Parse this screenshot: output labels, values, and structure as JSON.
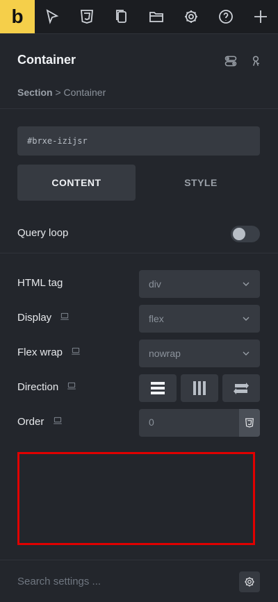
{
  "app": {
    "logo_letter": "b"
  },
  "topbar": {
    "icons": [
      "pointer-icon",
      "css3-icon",
      "pages-icon",
      "folder-icon",
      "settings-icon",
      "help-icon",
      "add-icon"
    ]
  },
  "panel": {
    "title": "Container",
    "breadcrumb": {
      "root": "Section",
      "separator": ">",
      "current": "Container"
    }
  },
  "element": {
    "id": "#brxe-izijsr"
  },
  "tabs": [
    {
      "label": "CONTENT",
      "active": true
    },
    {
      "label": "STYLE",
      "active": false
    }
  ],
  "query_loop": {
    "label": "Query loop",
    "enabled": false
  },
  "settings": {
    "html_tag": {
      "label": "HTML tag",
      "value": "div"
    },
    "display": {
      "label": "Display",
      "value": "flex"
    },
    "flex_wrap": {
      "label": "Flex wrap",
      "value": "nowrap"
    },
    "direction": {
      "label": "Direction"
    },
    "order": {
      "label": "Order",
      "value": "0"
    }
  },
  "footer": {
    "search_placeholder": "Search settings ..."
  },
  "colors": {
    "accent": "#f5cf4a",
    "highlight_box": "#e00000"
  }
}
